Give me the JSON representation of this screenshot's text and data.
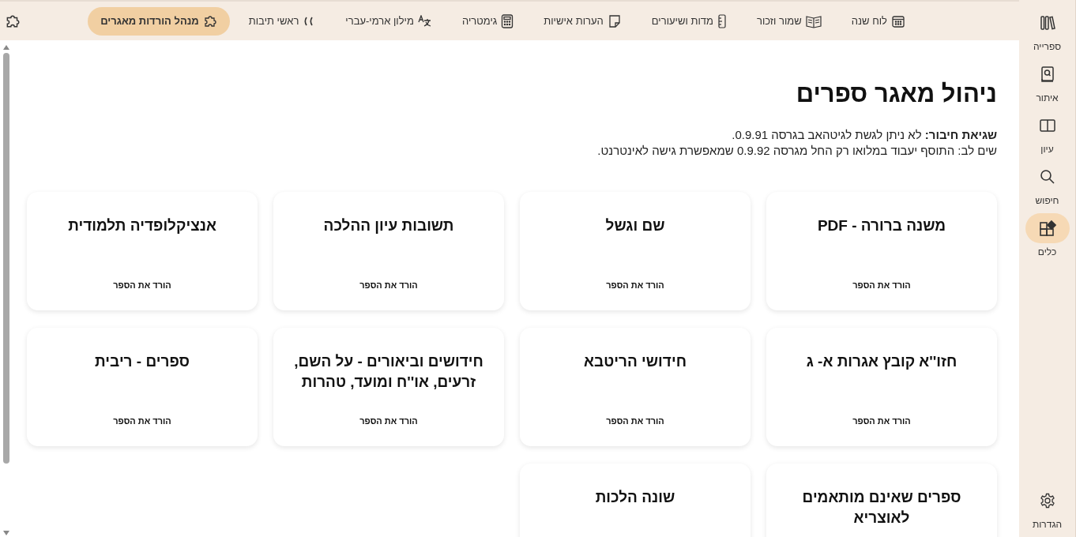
{
  "toolbar": {
    "items": [
      {
        "label": "לוח שנה",
        "kind": "calendar",
        "selected": false
      },
      {
        "label": "שמור וזכור",
        "kind": "book",
        "selected": false
      },
      {
        "label": "מדות ושיעורים",
        "kind": "ruler",
        "selected": false
      },
      {
        "label": "הערות אישיות",
        "kind": "note",
        "selected": false
      },
      {
        "label": "גימטריה",
        "kind": "calculator",
        "selected": false
      },
      {
        "label": "מילון ארמי-עברי",
        "kind": "translate",
        "selected": false
      },
      {
        "label": "ראשי תיבות",
        "kind": "quote",
        "selected": false
      },
      {
        "label": "מנהל הורדות מאגרים",
        "kind": "puzzle",
        "selected": true
      }
    ]
  },
  "sidebar": {
    "items": [
      {
        "label": "ספרייה",
        "kind": "library",
        "selected": false
      },
      {
        "label": "איתור",
        "kind": "find",
        "selected": false
      },
      {
        "label": "עיון",
        "kind": "read",
        "selected": false
      },
      {
        "label": "חיפוש",
        "kind": "search",
        "selected": false
      },
      {
        "label": "כלים",
        "kind": "tools",
        "selected": true
      }
    ],
    "footer": {
      "label": "הגדרות",
      "kind": "settings"
    }
  },
  "page": {
    "title": "ניהול מאגר ספרים",
    "notices": [
      "**שגיאת חיבור:** לא ניתן לגשת לגיטהאב בגרסה 0.9.91.",
      "שים לב: התוסף יעבוד במלואו רק החל מגרסה 0.9.92 שמאפשרת גישה לאינטרנט."
    ],
    "cards": [
      {
        "title": "משנה ברורה - PDF",
        "button": "הורד את הספר"
      },
      {
        "title": "שם וגשל",
        "button": "הורד את הספר"
      },
      {
        "title": "תשובות עיון ההלכה",
        "button": "הורד את הספר"
      },
      {
        "title": "אנציקלופדיה תלמודית",
        "button": "הורד את הספר"
      },
      {
        "title": "חזו''א קובץ אגרות א- ג",
        "button": "הורד את הספר"
      },
      {
        "title": "חידושי הריטבא",
        "button": "הורד את הספר"
      },
      {
        "title": "חידושים וביאורים - על השם, זרעים, או''ח ומועד, טהרות",
        "button": "הורד את הספר"
      },
      {
        "title": "ספרים - ריבית",
        "button": "הורד את הספר"
      },
      {
        "title": "ספרים שאינם מותאמים לאוצריא"
      },
      {
        "title": "שונה הלכות"
      }
    ]
  }
}
